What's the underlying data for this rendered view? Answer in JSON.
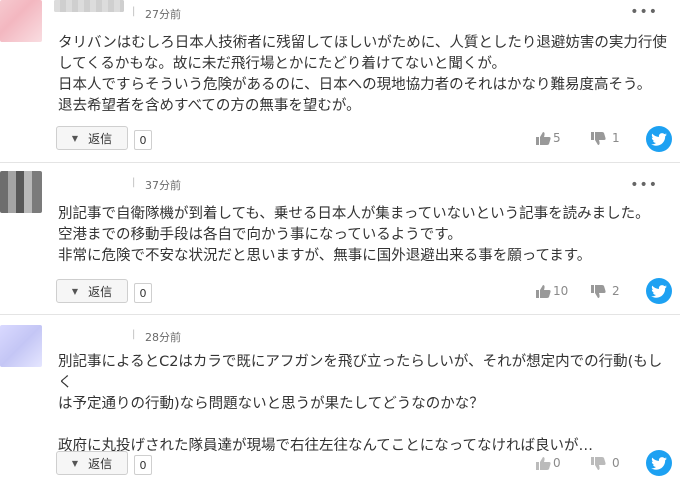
{
  "comments": [
    {
      "time": "27分前",
      "text": "タリバンはむしろ日本人技術者に残留してほしいがために、人質としたり退避妨害の実力行使\nしてくるかもな。故に未だ飛行場とかにたどり着けてないと聞くが。\n日本人ですらそういう危険があるのに、日本への現地協力者のそれはかなり難易度高そう。\n退去希望者を含めすべての方の無事を望むが。",
      "reply_label": "返信",
      "reply_count": "0",
      "likes": "5",
      "dislikes": "1"
    },
    {
      "time": "37分前",
      "text": "別記事で自衛隊機が到着しても、乗せる日本人が集まっていないという記事を読みました。\n空港までの移動手段は各自で向かう事になっているようです。\n非常に危険で不安な状況だと思いますが、無事に国外退避出来る事を願ってます。",
      "reply_label": "返信",
      "reply_count": "0",
      "likes": "10",
      "dislikes": "2"
    },
    {
      "time": "28分前",
      "text": "別記事によるとC2はカラで既にアフガンを飛び立ったらしいが、それが想定内での行動(もしく\nは予定通りの行動)なら問題ないと思うが果たしてどうなのかな？\n\n政府に丸投げされた隊員達が現場で右往左往なんてことになってなければ良いが…",
      "reply_label": "返信",
      "reply_count": "0",
      "likes": "0",
      "dislikes": "0"
    }
  ],
  "ui": {
    "separator": "|",
    "more_glyph": "•••",
    "reply_arrow": "▼",
    "twitter_color": "#1da1f2"
  }
}
